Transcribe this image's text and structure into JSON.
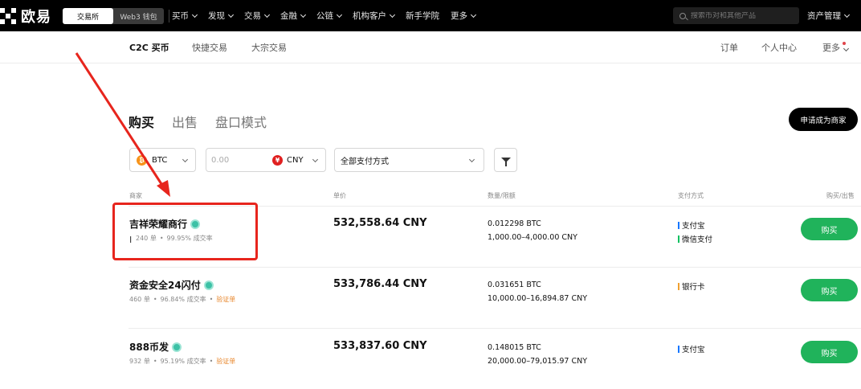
{
  "topbar": {
    "logo_text": "欧易",
    "switch": [
      "交易所",
      "Web3 钱包"
    ],
    "nav": [
      "买币",
      "发现",
      "交易",
      "金融",
      "公链",
      "机构客户",
      "新手学院",
      "更多"
    ],
    "nav_has_dropdown": [
      true,
      true,
      true,
      true,
      true,
      true,
      false,
      true
    ],
    "search_placeholder": "搜索币对和其他产品",
    "assets_label": "资产管理"
  },
  "subnav": {
    "left": [
      "C2C 买币",
      "快捷交易",
      "大宗交易"
    ],
    "right": [
      "订单",
      "个人中心",
      "更多"
    ]
  },
  "tabs": [
    "购买",
    "出售",
    "盘口模式"
  ],
  "merchant_button": "申请成为商家",
  "filters": {
    "coin": "BTC",
    "coin_symbol": "₿",
    "amount_placeholder": "0.00",
    "fiat": "CNY",
    "fiat_symbol": "¥",
    "payment": "全部支付方式"
  },
  "columns": [
    "商家",
    "单价",
    "数量/限额",
    "支付方式",
    "购买/出售"
  ],
  "rows": [
    {
      "name": "吉祥荣耀商行",
      "orders": "240 单",
      "rate": "99.95% 成交率",
      "cert": "",
      "price": "532,558.64 CNY",
      "qty": "0.012298 BTC",
      "limit": "1,000.00–4,000.00 CNY",
      "payments": [
        "支付宝",
        "微信支付"
      ],
      "action": "购买"
    },
    {
      "name": "资金安全24闪付",
      "orders": "460 单",
      "rate": "96.84% 成交率",
      "cert": "验证单",
      "price": "533,786.44 CNY",
      "qty": "0.031651 BTC",
      "limit": "10,000.00–16,894.87 CNY",
      "payments": [
        "银行卡"
      ],
      "action": "购买"
    },
    {
      "name": "888币发",
      "orders": "932 单",
      "rate": "95.19% 成交率",
      "cert": "验证单",
      "price": "533,837.60 CNY",
      "qty": "0.148015 BTC",
      "limit": "20,000.00–79,015.97 CNY",
      "payments": [
        "支付宝"
      ],
      "action": "购买"
    }
  ],
  "colors": {
    "buy_green": "#20b35b",
    "highlight_red": "#e7251d",
    "verified_teal": "#3cc1a6",
    "alipay_blue": "#1677ff",
    "wechat_green": "#07c160",
    "bank_orange": "#f0a030"
  }
}
